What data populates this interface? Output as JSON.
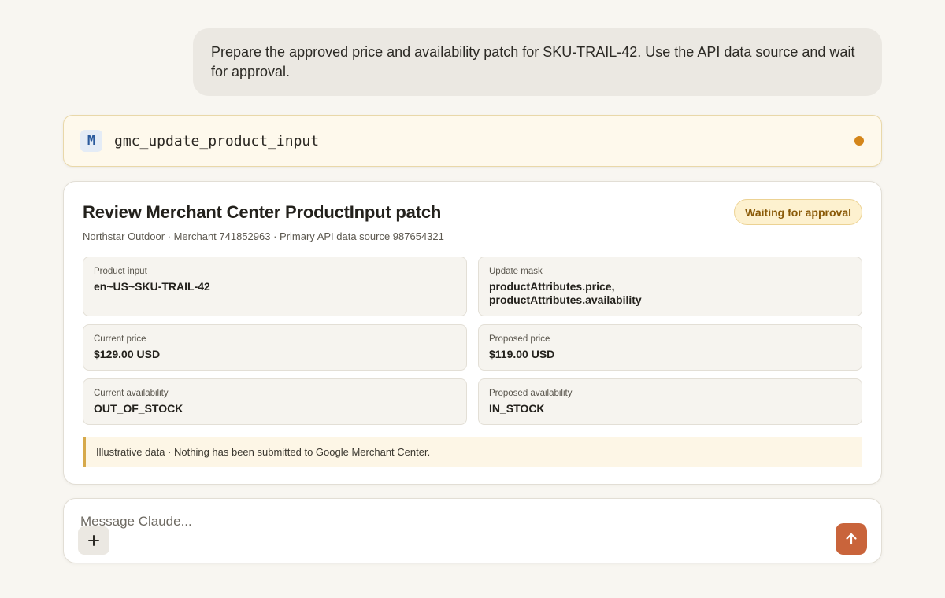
{
  "conversation": {
    "user_message": "Prepare the approved price and availability patch for SKU-TRAIL-42. Use the API data source and wait for approval."
  },
  "tool_call": {
    "badge": "M",
    "name": "gmc_update_product_input",
    "status_icon": "pending-dot-icon",
    "status_color": "#d4861a"
  },
  "review_card": {
    "title": "Review Merchant Center ProductInput patch",
    "subtitle": "Northstar Outdoor · Merchant 741852963 · Primary API data source 987654321",
    "status_badge": "Waiting for approval",
    "fields": {
      "product_input": {
        "label": "Product input",
        "value": "en~US~SKU-TRAIL-42"
      },
      "update_mask": {
        "label": "Update mask",
        "value_line1": "productAttributes.price,",
        "value_line2": "productAttributes.availability"
      },
      "current_price": {
        "label": "Current price",
        "value": "$129.00 USD"
      },
      "proposed_price": {
        "label": "Proposed price",
        "value": "$119.00 USD"
      },
      "current_availability": {
        "label": "Current availability",
        "value": "OUT_OF_STOCK"
      },
      "proposed_availability": {
        "label": "Proposed availability",
        "value": "IN_STOCK"
      }
    },
    "notice": "Illustrative data · Nothing has been submitted to Google Merchant Center."
  },
  "composer": {
    "placeholder": "Message Claude...",
    "value": "",
    "add_icon": "plus-icon",
    "send_icon": "arrow-up-icon",
    "send_color": "#c9643b"
  }
}
